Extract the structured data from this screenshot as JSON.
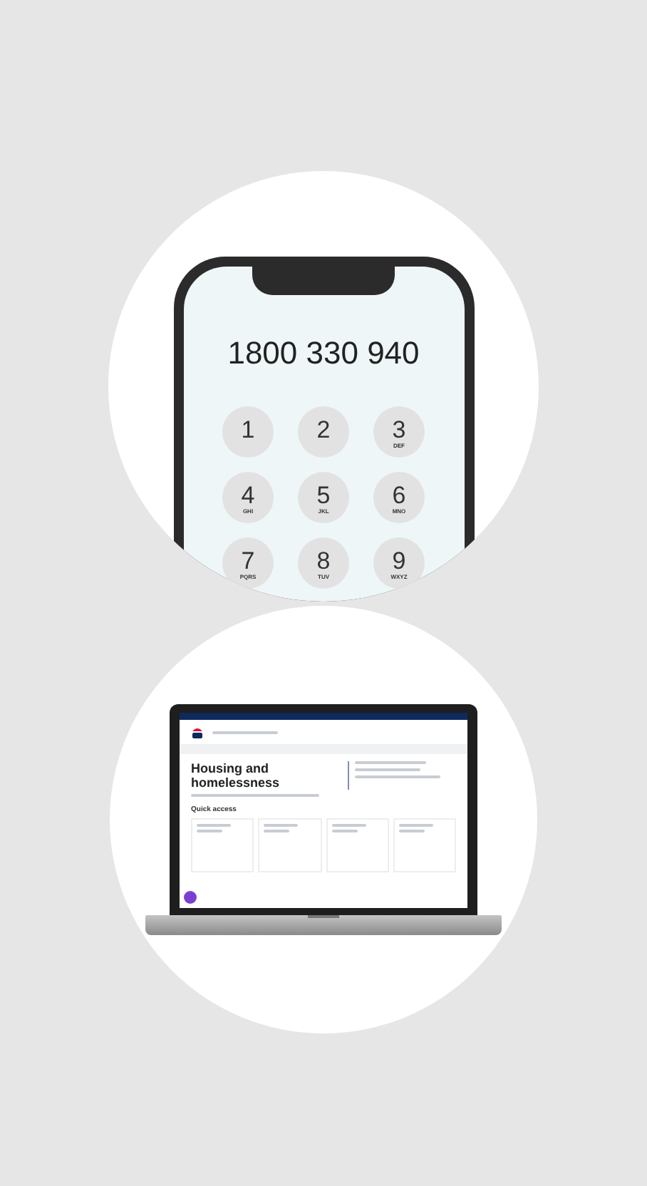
{
  "phone": {
    "dialed_number": "1800 330 940",
    "keys": [
      {
        "digit": "1"
      },
      {
        "digit": "2"
      },
      {
        "digit": "3",
        "letters": "DEF"
      },
      {
        "digit": "4",
        "letters": "GHI"
      },
      {
        "digit": "5",
        "letters": "JKL"
      },
      {
        "digit": "6",
        "letters": "MNO"
      },
      {
        "digit": "7",
        "letters": "PQRS"
      },
      {
        "digit": "8",
        "letters": "TUV"
      },
      {
        "digit": "9",
        "letters": "WXYZ"
      }
    ]
  },
  "laptop": {
    "page_title": "Housing and homelessness",
    "section_heading": "Quick access"
  }
}
